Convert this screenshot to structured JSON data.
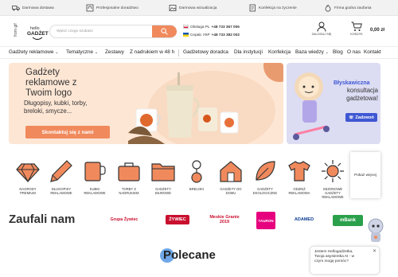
{
  "topbar": {
    "items": [
      {
        "icon": "truck-icon",
        "label": "Darmowa dostawa"
      },
      {
        "icon": "headset-icon",
        "label": "Profesjonalne doradztwo"
      },
      {
        "icon": "image-icon",
        "label": "Darmowa wizualizacja"
      },
      {
        "icon": "document-icon",
        "label": "Konfekcja na życzenie"
      },
      {
        "icon": "fire-icon",
        "label": "Firma godna zaufania"
      }
    ]
  },
  "header": {
    "logo_text": "hello GADŻET",
    "logo_side": "from gift",
    "search_placeholder": "Wpisz czego szukasz",
    "phone_pl_label": "Obsługa PL",
    "phone_pl_number": "+48 733 367 006",
    "phone_ua_label": "Сервіс УКР",
    "phone_ua_number": "+48 733 382 002",
    "account_label": "ZALOGUJ SIĘ",
    "cart_label": "KOSZYK",
    "cart_total": "0,00 zł"
  },
  "nav": {
    "items": [
      "Gadżety reklamowe",
      "Tematyczne",
      "Zestawy",
      "Z nadrukiem w 48 h",
      "Gadżetowy doradca",
      "Dla instytucji",
      "Konfekcja",
      "Baza wiedzy",
      "Blog",
      "O nas",
      "Kontakt"
    ]
  },
  "hero": {
    "title_line1": "Gadżety",
    "title_line2": "reklamowe z",
    "title_line3": "Twoim logo",
    "sub_line1": "Długopisy, kubki, torby,",
    "sub_line2": "breloki, smycze...",
    "button": "Skontaktuj się z nami"
  },
  "promo": {
    "line1": "Błyskawiczna",
    "line2": "konsultacja",
    "line3": "gadżetowa!",
    "button": "Zadzwoń"
  },
  "categories": [
    {
      "icon": "diamond-icon",
      "l1": "NAGRODY",
      "l2": "PREMIUM",
      "l3": ""
    },
    {
      "icon": "pen-icon",
      "l1": "DŁUGOPISY",
      "l2": "REKLAMOWE",
      "l3": ""
    },
    {
      "icon": "mug-icon",
      "l1": "KUBKI",
      "l2": "REKLAMOWE",
      "l3": ""
    },
    {
      "icon": "bag-icon",
      "l1": "TORBY Z",
      "l2": "NADRUKIEM",
      "l3": ""
    },
    {
      "icon": "folder-icon",
      "l1": "GADŻETY",
      "l2": "BIUROWE",
      "l3": ""
    },
    {
      "icon": "keychain-icon",
      "l1": "BRELOKI",
      "l2": "",
      "l3": ""
    },
    {
      "icon": "house-icon",
      "l1": "GADŻETY DO",
      "l2": "DOMU",
      "l3": ""
    },
    {
      "icon": "leaf-icon",
      "l1": "GADŻETY",
      "l2": "EKOLOGICZNE",
      "l3": ""
    },
    {
      "icon": "tshirt-icon",
      "l1": "ODZIEŻ",
      "l2": "REKLAMOWA",
      "l3": ""
    },
    {
      "icon": "sun-icon",
      "l1": "SEZONOWE",
      "l2": "GADŻETY",
      "l3": "REKLAMOWE"
    }
  ],
  "more_card": "Pokaż więcej",
  "trusted": {
    "title": "Zaufali nam",
    "brands": [
      "Grupa Żywiec",
      "ŻYWIEC",
      "Meskie Granie 2019",
      "TAURON",
      "ADAMED",
      "mBank"
    ]
  },
  "polecane": {
    "title": "Polecane"
  },
  "chat": {
    "line1": "Jestem Hellogadżetka,",
    "line2": "Twoja asystentka AI - w",
    "line3": "czym mogę pomóc?",
    "close": "✕"
  },
  "colors": {
    "accent": "#f08a5d",
    "hero_bg": "#fde6d4",
    "promo_bg": "#dcdcf3",
    "promo_blue": "#3e57d3"
  }
}
